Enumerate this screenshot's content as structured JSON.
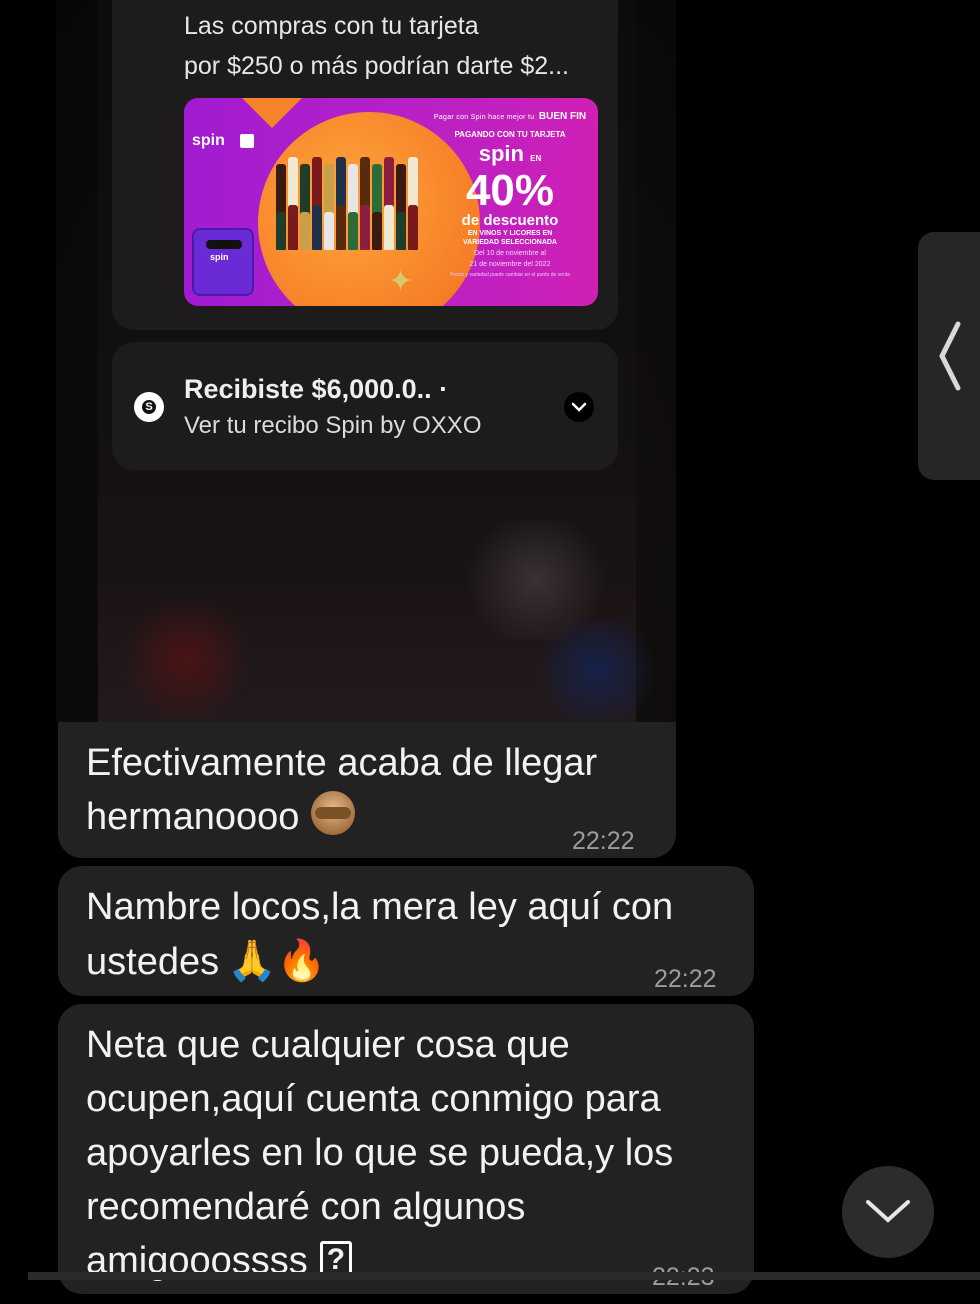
{
  "screenshot": {
    "notification1": {
      "line1": "Las compras con tu tarjeta",
      "line2": "por $250 o más podrían darte $2..."
    },
    "promo": {
      "brand": "spin",
      "tagline": "Pagar con Spin hace mejor tu",
      "event": "BUEN FIN",
      "paying_line": "PAGANDO CON TU TARJETA",
      "spin_big": "spin",
      "spin_en": "EN",
      "discount": "40%",
      "discount_label": "de descuento",
      "category_line1": "EN VINOS Y LICORES EN",
      "category_line2": "VARIEDAD SELECCIONADA",
      "date_line1": "Del 10 de noviembre al",
      "date_line2": "21 de noviembre del 2022",
      "fine_print": "Precio y variedad puede cambiar en el punto de venta",
      "mascot_label": "spin",
      "colors": {
        "bg": "#b521c8",
        "circle": "#f7842a"
      }
    },
    "notification2": {
      "icon": "s-circle-icon",
      "title": "Recibiste $6,000.0.. ·",
      "subtitle": "Ver tu recibo Spin by OXXO"
    }
  },
  "messages": [
    {
      "lines": [
        "Efectivamente acaba de llegar",
        "hermanoooo"
      ],
      "emoji": "see-no-evil-monkey",
      "time": "22:22"
    },
    {
      "lines": [
        "Nambre locos,la mera ley aquí con",
        "ustedes"
      ],
      "emoji": "folded-hands fire",
      "time": "22:22"
    },
    {
      "lines": [
        "Neta que cualquier cosa que",
        "ocupen,aquí cuenta conmigo para",
        "apoyarles en lo que se pueda,y los",
        "recomendaré con algunos",
        "amigooossss"
      ],
      "emoji": "?",
      "time": "22:23"
    }
  ],
  "colors": {
    "bubble": "#222222",
    "background": "#000000"
  }
}
